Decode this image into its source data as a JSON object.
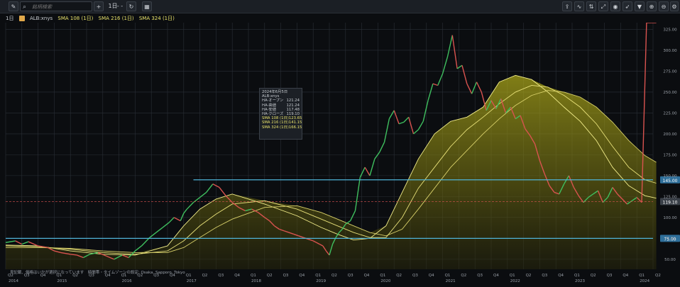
{
  "toolbar": {
    "menu_icon": "pencil-icon",
    "search_placeholder": "銘柄検索",
    "add_label": "+",
    "interval_label": "1日",
    "style_label": "- -",
    "refresh_icon": "refresh-icon",
    "right_icons": [
      "share-icon",
      "indicator-icon",
      "compare-icon",
      "expand-icon",
      "eye-icon",
      "cursor-icon",
      "filter-icon",
      "zoom-in-icon",
      "zoom-out-icon",
      "settings-icon"
    ]
  },
  "legend": {
    "interval": "1日",
    "symbol": "ALB:xnys",
    "sma1": "SMA 108 (1日)",
    "sma2": "SMA 216 (1日)",
    "sma3": "SMA 324 (1日)"
  },
  "tooltip": {
    "date": "2024年6月5日",
    "symbol": "ALB:xnys",
    "rows": [
      {
        "label": "HA-オープン",
        "value": "121.24"
      },
      {
        "label": "HA-高値",
        "value": "121.24"
      },
      {
        "label": "HA-安値",
        "value": "117.48"
      },
      {
        "label": "HA-クローズ",
        "value": "119.10"
      },
      {
        "label": "SMA 108 (1日)",
        "value": "123.65"
      },
      {
        "label": "SMA 216 (1日)",
        "value": "141.15"
      },
      {
        "label": "SMA 324 (1日)",
        "value": "166.15"
      }
    ]
  },
  "footer_note": "見記載、価格はいかが選択になっています　時間帯・タイムゾーンの設定: Osaka, Sapporo, Tokyo",
  "chart_data": {
    "type": "line",
    "symbol": "ALB:xnys",
    "y_ticks": [
      50,
      75,
      100,
      125,
      150,
      175,
      200,
      225,
      250,
      275,
      300,
      325
    ],
    "ylim": [
      38,
      333
    ],
    "x_quarters": [
      "Q2",
      "Q3",
      "Q4",
      "Q1",
      "Q2",
      "Q3",
      "Q4",
      "Q1",
      "Q2",
      "Q3",
      "Q4",
      "Q1",
      "Q2",
      "Q3",
      "Q4",
      "Q1",
      "Q2",
      "Q3",
      "Q4",
      "Q1",
      "Q2",
      "Q3",
      "Q4",
      "Q1",
      "Q2",
      "Q3",
      "Q4",
      "Q1",
      "Q2",
      "Q3",
      "Q4",
      "Q1",
      "Q2",
      "Q3",
      "Q4",
      "Q1",
      "Q2",
      "Q3",
      "Q4",
      "Q1",
      "Q2"
    ],
    "x_years": [
      "2014",
      "2015",
      "2016",
      "2017",
      "2018",
      "2019",
      "2020",
      "2021",
      "2022",
      "2023",
      "2024"
    ],
    "price_series": {
      "name": "ALB:xnys",
      "x": [
        0,
        0.6,
        1,
        1.4,
        2,
        2.6,
        3,
        3.4,
        4,
        4.4,
        4.8,
        5.2,
        5.7,
        6.2,
        6.7,
        7.2,
        7.6,
        8,
        8.4,
        8.9,
        9.3,
        9.7,
        10.1,
        10.4,
        10.8,
        11,
        11.2,
        11.6,
        12.0,
        12.4,
        12.8,
        13.2,
        13.6,
        14,
        14.4,
        14.8,
        15.2,
        15.6,
        16,
        16.3,
        16.6,
        16.9,
        17.2,
        17.5,
        17.8,
        18.1,
        18.4,
        18.7,
        19,
        19.2,
        19.4,
        19.6,
        19.8,
        20.0,
        20.2,
        20.4,
        20.6,
        20.8,
        21.0,
        21.3,
        21.6,
        21.9,
        22.2,
        22.5,
        22.8,
        23.1,
        23.4,
        23.7,
        24,
        24.3,
        24.6,
        24.9,
        25.2,
        25.5,
        25.8,
        26.1,
        26.4,
        26.7,
        27,
        27.3,
        27.6,
        27.9,
        28.2,
        28.5,
        28.8,
        29.1,
        29.4,
        29.7,
        30,
        30.3,
        30.6,
        30.9,
        31.2,
        31.5,
        31.8,
        32.1,
        32.4,
        32.7,
        33,
        33.3,
        33.6,
        33.9,
        34.2,
        34.5,
        34.8,
        35.1,
        35.4,
        35.7,
        36,
        36.3,
        36.6,
        36.9,
        37.2,
        37.5,
        37.8,
        38.1,
        38.4,
        38.7,
        39,
        39.3,
        39.6,
        39.9,
        40.2
      ],
      "values": [
        70,
        72,
        68,
        71,
        66,
        64,
        60,
        58,
        56,
        55,
        52,
        56,
        58,
        54,
        50,
        55,
        52,
        60,
        66,
        76,
        82,
        88,
        94,
        100,
        96,
        105,
        110,
        118,
        124,
        130,
        140,
        136,
        126,
        118,
        112,
        108,
        110,
        106,
        100,
        96,
        90,
        86,
        84,
        82,
        80,
        78,
        76,
        74,
        72,
        70,
        68,
        66,
        60,
        55,
        68,
        76,
        82,
        86,
        92,
        96,
        108,
        148,
        160,
        150,
        170,
        178,
        190,
        218,
        228,
        212,
        214,
        220,
        200,
        205,
        215,
        240,
        260,
        258,
        272,
        292,
        318,
        278,
        282,
        260,
        248,
        262,
        250,
        228,
        240,
        230,
        242,
        225,
        232,
        218,
        222,
        206,
        198,
        188,
        168,
        152,
        138,
        130,
        128,
        140,
        150,
        136,
        126,
        118,
        124,
        128,
        132,
        118,
        124,
        136,
        128,
        122,
        116,
        120,
        124,
        118
      ]
    },
    "sma_series": [
      {
        "name": "SMA 108 (1日)",
        "x": [
          0,
          2,
          4,
          6,
          8,
          10,
          11,
          12,
          13,
          14,
          16,
          18,
          19.5,
          20.5,
          21.5,
          22.5,
          23.5,
          24.5,
          25.5,
          26.5,
          27.5,
          28.5,
          29.5,
          30.5,
          31.5,
          32.5,
          33.5,
          34.5,
          35.5,
          36.5,
          37.5,
          38.5,
          39.5,
          40.2
        ],
        "values": [
          67,
          66,
          60,
          56,
          55,
          66,
          90,
          110,
          122,
          128,
          116,
          102,
          88,
          80,
          73,
          75,
          90,
          130,
          170,
          200,
          215,
          220,
          232,
          262,
          270,
          265,
          250,
          232,
          215,
          192,
          160,
          138,
          126,
          123
        ]
      },
      {
        "name": "SMA 216 (1日)",
        "x": [
          0,
          2,
          4,
          6,
          8,
          10,
          11,
          12,
          13,
          14,
          16,
          18,
          19.5,
          20.5,
          21.5,
          22.5,
          23.5,
          24.5,
          25.5,
          26.5,
          27.5,
          28.5,
          29.5,
          30.5,
          31.5,
          32.5,
          33.5,
          34.5,
          35.5,
          36.5,
          37.5,
          38.5,
          39.5,
          40.2
        ],
        "values": [
          66,
          65,
          62,
          58,
          56,
          60,
          72,
          90,
          104,
          116,
          120,
          110,
          98,
          90,
          82,
          76,
          76,
          100,
          135,
          160,
          185,
          205,
          220,
          236,
          250,
          258,
          256,
          246,
          232,
          212,
          185,
          160,
          145,
          141
        ]
      },
      {
        "name": "SMA 324 (1日)",
        "x": [
          0,
          2,
          4,
          6,
          8,
          10,
          11,
          12,
          13,
          14,
          16,
          18,
          19.5,
          20.5,
          21.5,
          22.5,
          23.5,
          24.5,
          25.5,
          26.5,
          27.5,
          28.5,
          29.5,
          30.5,
          31.5,
          32.5,
          33.5,
          34.5,
          35.5,
          36.5,
          37.5,
          38.5,
          39.5,
          40.2
        ],
        "values": [
          64,
          64,
          63,
          60,
          58,
          58,
          64,
          76,
          88,
          98,
          112,
          114,
          106,
          98,
          90,
          82,
          78,
          86,
          110,
          135,
          160,
          180,
          200,
          218,
          234,
          246,
          252,
          250,
          244,
          232,
          214,
          192,
          174,
          166
        ]
      }
    ],
    "horizontal_lines": [
      {
        "value": 145.0,
        "label": "145.00",
        "color": "#4fb4d8"
      },
      {
        "value": 75.0,
        "label": "75.00",
        "color": "#4fb4d8"
      }
    ],
    "last_price": {
      "value": 119.1,
      "label": "119.10",
      "color": "#d9534f"
    },
    "grid": true
  }
}
